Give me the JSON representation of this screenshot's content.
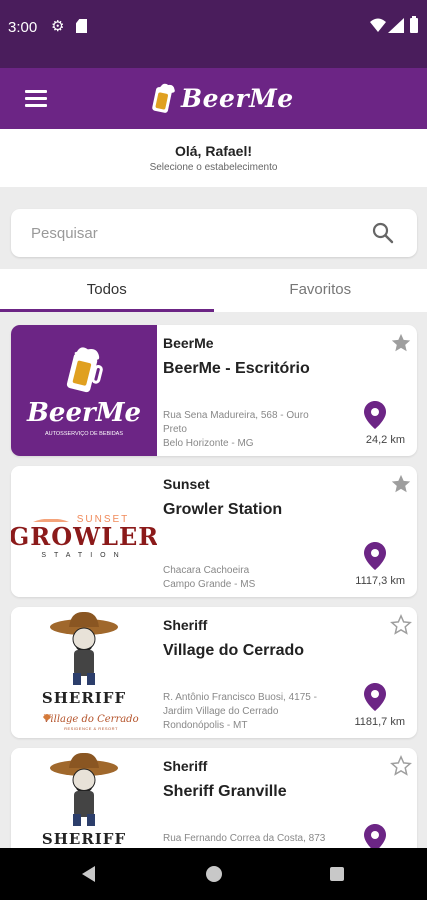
{
  "status_bar": {
    "time": "3:00"
  },
  "app_bar": {
    "brand": "BeerMe"
  },
  "greeting": {
    "hello": "Olá, Rafael!",
    "subtitle": "Selecione o estabelecimento"
  },
  "search": {
    "placeholder": "Pesquisar",
    "value": ""
  },
  "tabs": [
    {
      "label": "Todos",
      "active": true
    },
    {
      "label": "Favoritos",
      "active": false
    }
  ],
  "establishments": [
    {
      "brand": "BeerMe",
      "name": "BeerMe - Escritório",
      "address_lines": [
        "Rua Sena Madureira, 568 - Ouro",
        "Preto",
        "Belo Horizonte - MG"
      ],
      "distance": "24,2 km",
      "favorite": true,
      "logo_text": "BeerMe",
      "logo_tagline": "AUTOSSERVIÇO DE BEBIDAS"
    },
    {
      "brand": "Sunset",
      "name": "Growler Station",
      "address_lines": [
        "Chacara Cachoeira",
        "Campo Grande - MS"
      ],
      "distance": "1117,3 km",
      "favorite": true,
      "logo_top": "SUNSET",
      "logo_main": "GROWLER",
      "logo_bottom": "STATION"
    },
    {
      "brand": "Sheriff",
      "name": "Village do Cerrado",
      "address_lines": [
        "R. Antônio Francisco Buosi, 4175 -",
        "Jardim Village do Cerrado",
        "Rondonópolis - MT"
      ],
      "distance": "1181,7 km",
      "favorite": false,
      "logo_main": "SHERIFF",
      "logo_sub": "Village do Cerrado",
      "logo_sub2": "RESIDENCE & RESORT"
    },
    {
      "brand": "Sheriff",
      "name": "Sheriff Granville",
      "address_lines": [
        "Rua Fernando Correa da Costa, 873"
      ],
      "distance": "",
      "favorite": false,
      "logo_main": "SHERIFF"
    }
  ],
  "colors": {
    "primary": "#6c2585",
    "status_bar": "#4a1d5c",
    "star_filled": "#9e9e9e"
  }
}
